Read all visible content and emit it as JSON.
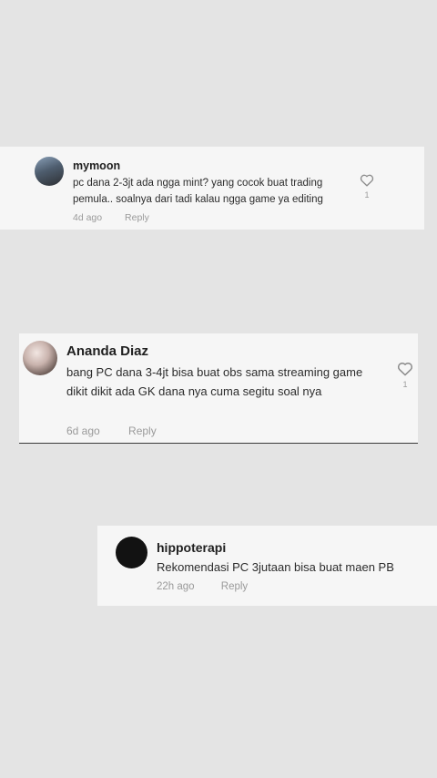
{
  "comments": [
    {
      "username": "mymoon",
      "text": "pc dana 2-3jt ada ngga mint? yang cocok buat trading pemula.. soalnya dari tadi kalau ngga game ya editing",
      "time": "4d ago",
      "reply_label": "Reply",
      "likes": "1",
      "like_icon": "heart-outline-icon"
    },
    {
      "username": "Ananda Diaz",
      "text": "bang PC dana 3-4jt bisa buat obs sama streaming game dikit dikit ada GK dana nya cuma segitu soal nya",
      "time": "6d ago",
      "reply_label": "Reply",
      "likes": "1",
      "like_icon": "heart-outline-icon"
    },
    {
      "username": "hippoterapi",
      "text": "Rekomendasi PC 3jutaan bisa buat maen PB",
      "time": "22h ago",
      "reply_label": "Reply"
    }
  ],
  "colors": {
    "background": "#e4e4e4",
    "card": "#f6f6f6",
    "text": "#2c2c2c",
    "meta": "#9a9a9a"
  }
}
